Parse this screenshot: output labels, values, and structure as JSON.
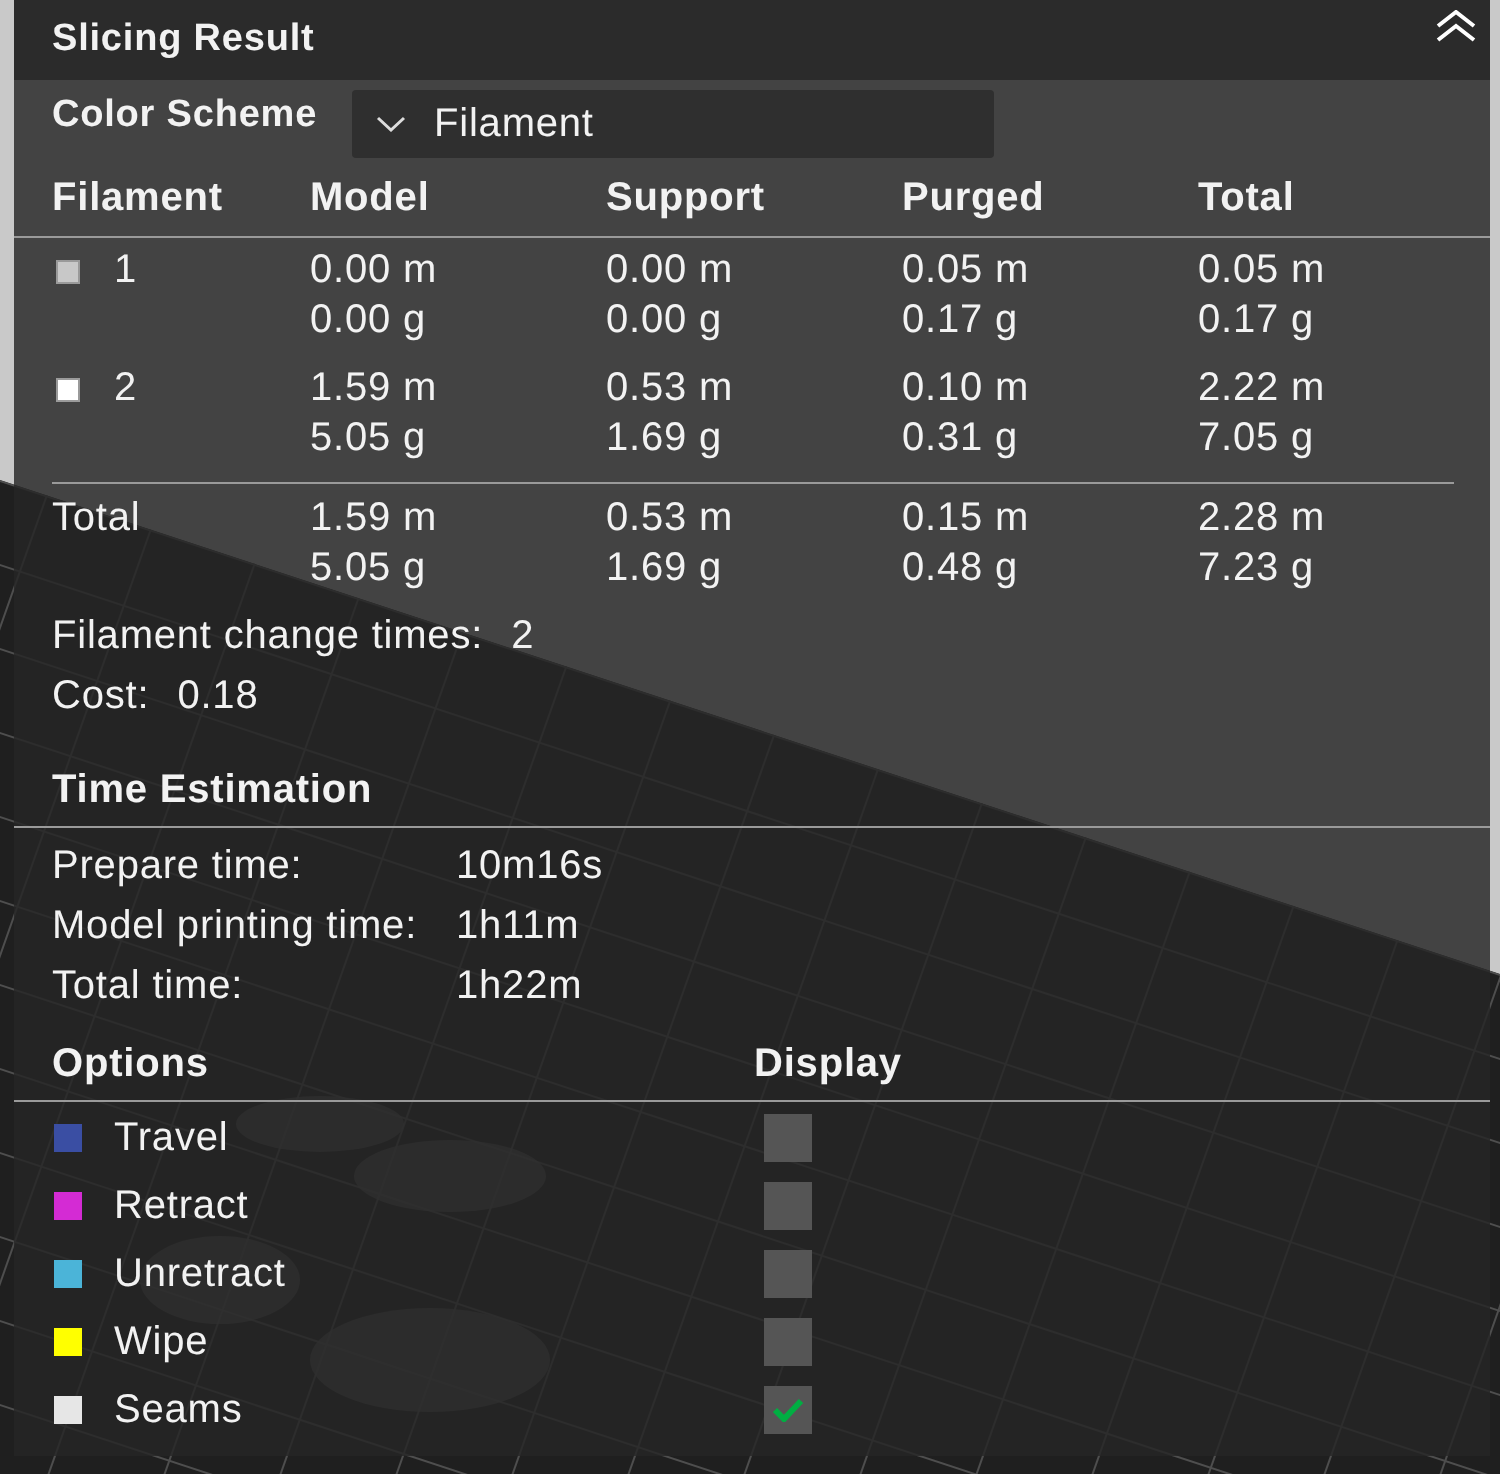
{
  "panel": {
    "title": "Slicing Result"
  },
  "color_scheme": {
    "label": "Color Scheme",
    "value": "Filament"
  },
  "filament_table": {
    "columns": [
      "Filament",
      "Model",
      "Support",
      "Purged",
      "Total"
    ],
    "rows": [
      {
        "filament": "1",
        "color": "#c8c8c8",
        "model": {
          "length": "0.00 m",
          "weight": "0.00 g"
        },
        "support": {
          "length": "0.00 m",
          "weight": "0.00 g"
        },
        "purged": {
          "length": "0.05 m",
          "weight": "0.17 g"
        },
        "total": {
          "length": "0.05 m",
          "weight": "0.17 g"
        }
      },
      {
        "filament": "2",
        "color": "#ffffff",
        "model": {
          "length": "1.59 m",
          "weight": "5.05 g"
        },
        "support": {
          "length": "0.53 m",
          "weight": "1.69 g"
        },
        "purged": {
          "length": "0.10 m",
          "weight": "0.31 g"
        },
        "total": {
          "length": "2.22 m",
          "weight": "7.05 g"
        }
      }
    ],
    "total_row": {
      "filament": "Total",
      "model": {
        "length": "1.59 m",
        "weight": "5.05 g"
      },
      "support": {
        "length": "0.53 m",
        "weight": "1.69 g"
      },
      "purged": {
        "length": "0.15 m",
        "weight": "0.48 g"
      },
      "total": {
        "length": "2.28 m",
        "weight": "7.23 g"
      }
    }
  },
  "summary": [
    {
      "label": "Filament change times:",
      "value": "2"
    },
    {
      "label": "Cost:",
      "value": "0.18"
    }
  ],
  "time_estimation": {
    "title": "Time Estimation",
    "rows": [
      {
        "label": "Prepare time:",
        "value": "10m16s"
      },
      {
        "label": "Model printing time:",
        "value": "1h11m"
      },
      {
        "label": "Total time:",
        "value": "1h22m"
      }
    ]
  },
  "options": {
    "columns": [
      "Options",
      "Display"
    ],
    "items": [
      {
        "label": "Travel",
        "color": "#3a4ea3",
        "checked": false
      },
      {
        "label": "Retract",
        "color": "#d42bd4",
        "checked": false
      },
      {
        "label": "Unretract",
        "color": "#4bb4d8",
        "checked": false
      },
      {
        "label": "Wipe",
        "color": "#ffff00",
        "checked": false
      },
      {
        "label": "Seams",
        "color": "#e6e6e6",
        "checked": true
      }
    ]
  }
}
